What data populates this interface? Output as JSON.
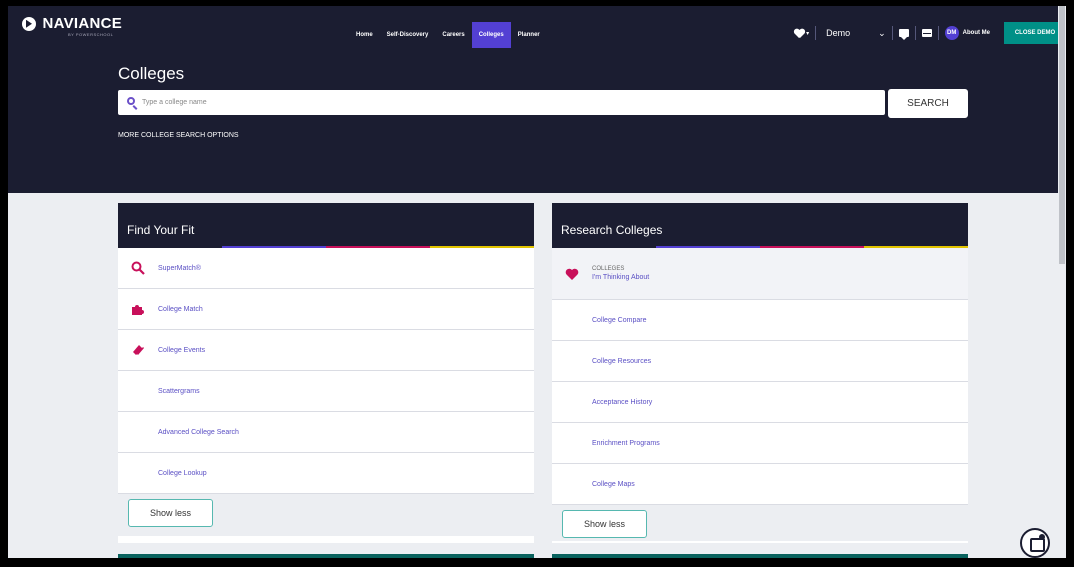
{
  "brand": {
    "name": "NAVIANCE",
    "sub": "BY POWERSCHOOL"
  },
  "nav": {
    "items": [
      {
        "label": "Home"
      },
      {
        "label": "Self-Discovery"
      },
      {
        "label": "Careers"
      },
      {
        "label": "Colleges",
        "active": true
      },
      {
        "label": "Planner"
      }
    ],
    "user_select": "Demo",
    "avatar_initials": "DM",
    "about_me": "About Me",
    "close_demo": "CLOSE DEMO"
  },
  "page": {
    "title": "Colleges",
    "search_placeholder": "Type a college name",
    "search_button": "SEARCH",
    "more_options": "MORE COLLEGE SEARCH OPTIONS"
  },
  "find_fit": {
    "title": "Find Your Fit",
    "items": [
      {
        "label": "SuperMatch®",
        "icon": "search-icon"
      },
      {
        "label": "College Match",
        "icon": "puzzle-icon"
      },
      {
        "label": "College Events",
        "icon": "ticket-icon"
      },
      {
        "label": "Scattergrams"
      },
      {
        "label": "Advanced College Search"
      },
      {
        "label": "College Lookup"
      }
    ],
    "show_less": "Show less"
  },
  "research": {
    "title": "Research Colleges",
    "thinking_small": "COLLEGES",
    "thinking_label": "I'm Thinking About",
    "items": [
      {
        "label": "College Compare"
      },
      {
        "label": "College Resources"
      },
      {
        "label": "Acceptance History"
      },
      {
        "label": "Enrichment Programs"
      },
      {
        "label": "College Maps"
      }
    ],
    "show_less": "Show less"
  },
  "colors": {
    "header_bg": "#1b1d31",
    "accent_purple": "#5340d3",
    "accent_teal": "#009087",
    "link": "#5a4fc4",
    "icon_pink": "#c8105a"
  }
}
